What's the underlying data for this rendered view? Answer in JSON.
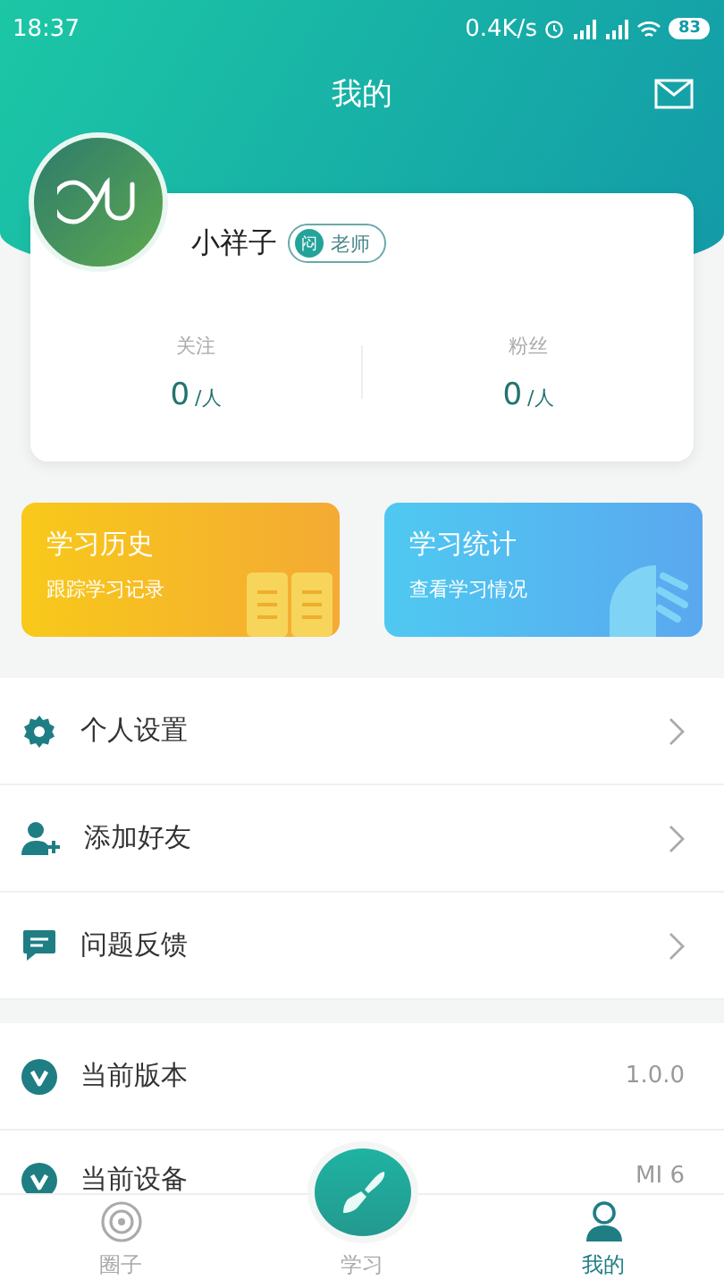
{
  "status_bar": {
    "time": "18:37",
    "speed": "0.4K/s",
    "battery": "83"
  },
  "header": {
    "title": "我的"
  },
  "profile": {
    "name": "小祥子",
    "role_badge": {
      "icon_text": "闷",
      "label": "老师"
    },
    "stats": [
      {
        "label": "关注",
        "value": "0",
        "unit": "/人"
      },
      {
        "label": "粉丝",
        "value": "0",
        "unit": "/人"
      }
    ]
  },
  "tiles": [
    {
      "kind": "history",
      "title": "学习历史",
      "subtitle": "跟踪学习记录"
    },
    {
      "kind": "stats",
      "title": "学习统计",
      "subtitle": "查看学习情况"
    }
  ],
  "menu_groups": [
    [
      {
        "kind": "settings",
        "label": "个人设置"
      },
      {
        "kind": "friend",
        "label": "添加好友"
      },
      {
        "kind": "feedback",
        "label": "问题反馈"
      }
    ],
    [
      {
        "kind": "version",
        "label": "当前版本",
        "value": "1.0.0"
      },
      {
        "kind": "device",
        "label": "当前设备",
        "value": "MI 6"
      }
    ]
  ],
  "tab_bar": [
    {
      "kind": "circle",
      "label": "圈子",
      "selected": false
    },
    {
      "kind": "center",
      "label": "学习",
      "selected": false
    },
    {
      "kind": "user",
      "label": "我的",
      "selected": true
    }
  ]
}
